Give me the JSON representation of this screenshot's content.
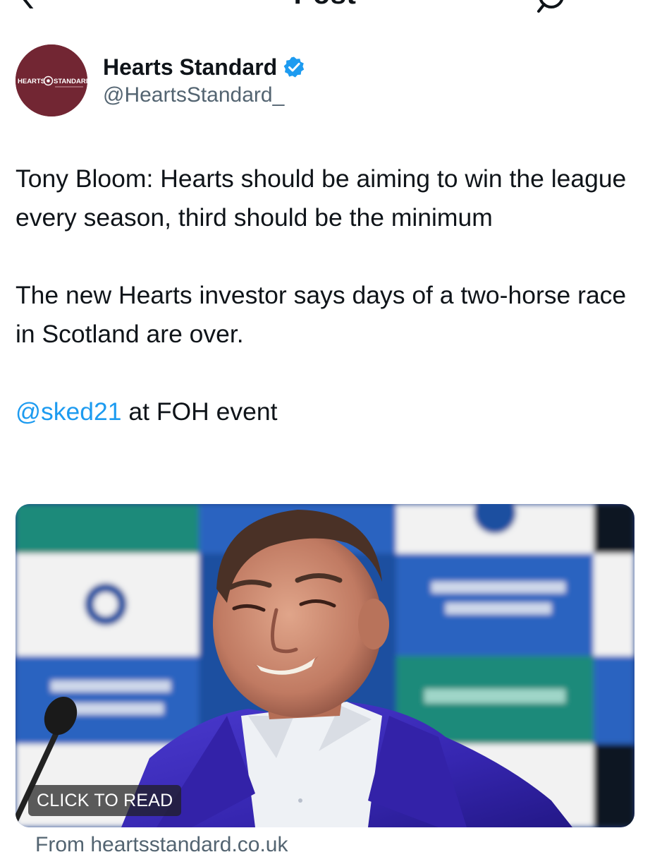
{
  "header": {
    "title": "Post",
    "back_icon": "back-arrow-icon",
    "reply_icon": "reply-icon"
  },
  "author": {
    "name": "Hearts Standard",
    "handle": "@HeartsStandard_",
    "verified": true,
    "avatar_text_left": "HEARTS",
    "avatar_text_right": "STANDARD",
    "avatar_color": "#722633"
  },
  "tweet": {
    "line1": "Tony Bloom: Hearts should be aiming to win the league every season, third should be the minimum",
    "line2": "The new Hearts investor says days of a two-horse race in Scotland are over.",
    "mention": "@sked21",
    "mention_suffix": " at FOH event"
  },
  "card": {
    "badge": "CLICK TO READ",
    "source": "From heartsstandard.co.uk"
  },
  "colors": {
    "link": "#1d9bf0",
    "secondary_text": "#536471",
    "verified": "#1d9bf0"
  }
}
